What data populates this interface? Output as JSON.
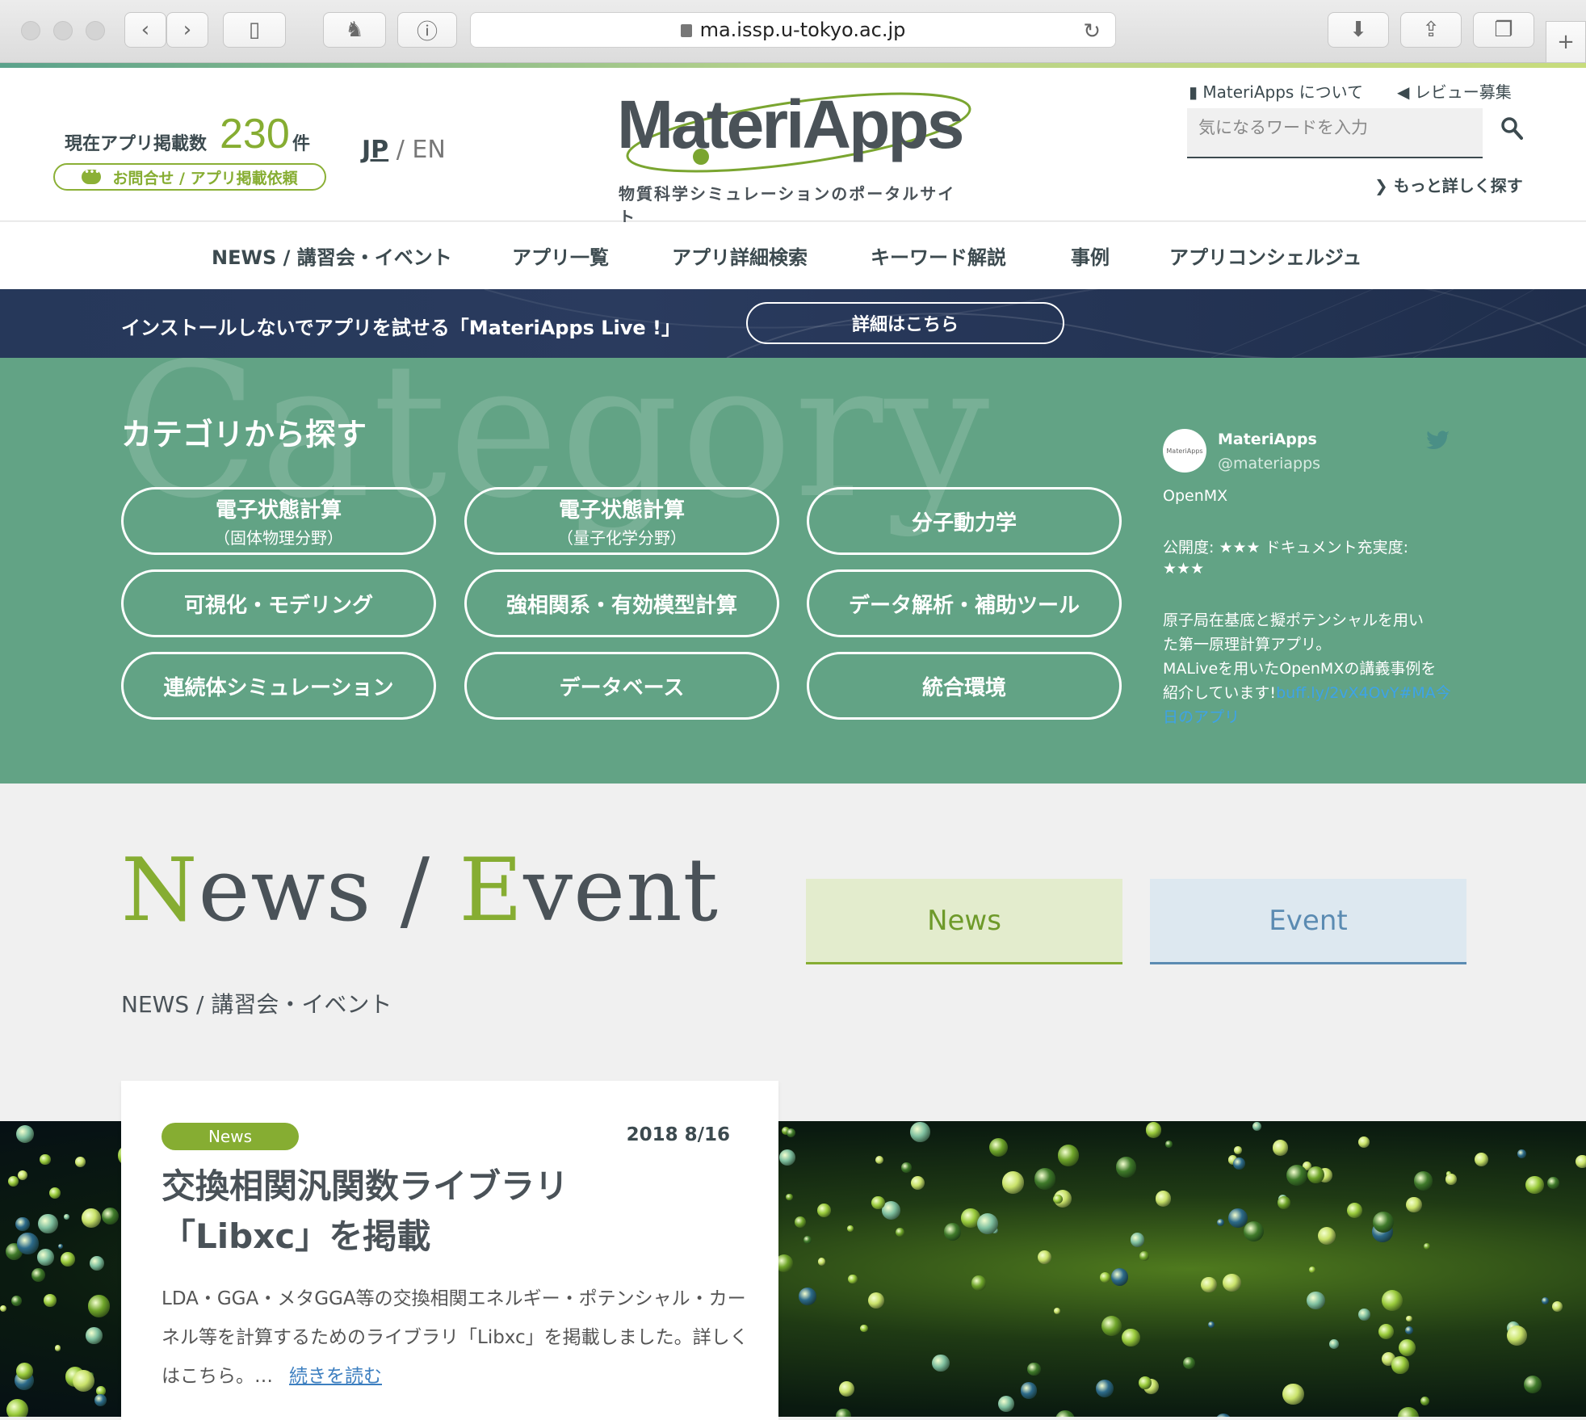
{
  "browser": {
    "url": "ma.issp.u-tokyo.ac.jp"
  },
  "header": {
    "count_label": "現在アプリ掲載数",
    "count_value": "230",
    "count_unit": "件",
    "contact_button": "お問合せ / アプリ掲載依頼",
    "lang_jp": "JP",
    "lang_sep": "/",
    "lang_en": "EN",
    "logo_text": "MateriApps",
    "logo_subtitle": "物質科学シミュレーションのポータルサイト",
    "about_link": "MateriApps について",
    "review_link": "レビュー募集",
    "search_placeholder": "気になるワードを入力",
    "more_search": "もっと詳しく探す"
  },
  "nav": {
    "items": [
      "NEWS / 講習会・イベント",
      "アプリ一覧",
      "アプリ詳細検索",
      "キーワード解説",
      "事例",
      "アプリコンシェルジュ"
    ]
  },
  "live_banner": {
    "text": "インストールしないでアプリを試せる「MateriApps Live !」",
    "button": "詳細はこちら"
  },
  "category": {
    "bg_word": "Category",
    "title": "カテゴリから探す",
    "buttons": [
      {
        "label": "電子状態計算",
        "sub": "（固体物理分野）"
      },
      {
        "label": "電子状態計算",
        "sub": "（量子化学分野）"
      },
      {
        "label": "分子動力学",
        "sub": ""
      },
      {
        "label": "可視化・モデリング",
        "sub": ""
      },
      {
        "label": "強相関系・有効模型計算",
        "sub": ""
      },
      {
        "label": "データ解析・補助ツール",
        "sub": ""
      },
      {
        "label": "連続体シミュレーション",
        "sub": ""
      },
      {
        "label": "データベース",
        "sub": ""
      },
      {
        "label": "統合環境",
        "sub": ""
      }
    ]
  },
  "twitter": {
    "avatar_text": "MateriApps",
    "name": "MateriApps",
    "handle": "@materiapps",
    "lines": [
      "OpenMX",
      "公開度: ★★★ ドキュメント充実度:",
      "★★★",
      "原子局在基底と擬ポテンシャルを用い",
      "た第一原理計算アプリ。",
      "MALiveを用いたOpenMXの講義事例を",
      "紹介しています!"
    ],
    "link_inline": "buff.ly/2vX4OvY#MA今",
    "link_line2": "日のアプリ"
  },
  "news_section": {
    "title_n": "N",
    "title_ews": "ews / ",
    "title_e": "E",
    "title_vent": "vent",
    "tab_news": "News",
    "tab_event": "Event",
    "breadcrumb": "NEWS / 講習会・イベント"
  },
  "card": {
    "badge": "News",
    "date": "2018 8/16",
    "title_line1": "交換相関汎関数ライブラリ",
    "title_line2": "「Libxc」を掲載",
    "body": "LDA・GGA・メタGGA等の交換相関エネルギー・ポテンシャル・カーネル等を計算するためのライブラリ「Libxc」を掲載しました。詳しくはこちら。…",
    "more": "続きを読む"
  },
  "colors": {
    "brand_green": "#86ad32",
    "category_bg": "#62a385",
    "banner_navy": "#26385a",
    "event_blue": "#5b8bb2"
  }
}
